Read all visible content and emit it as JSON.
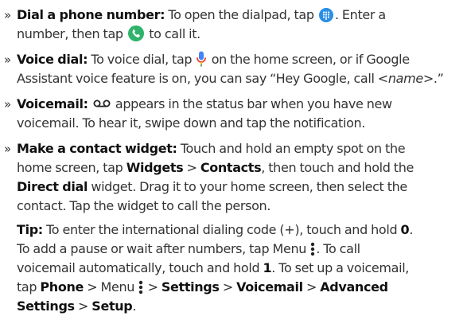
{
  "bullet_marker": "»",
  "items": [
    {
      "title": "Dial a phone number:",
      "text_1": " To open the dialpad, tap ",
      "icon_1": "dialpad-icon",
      "text_2": ". Enter a",
      "text_3": "number, then tap ",
      "icon_2": "phone-call-icon",
      "text_4": " to call it."
    },
    {
      "title": "Voice dial:",
      "text_1": " To voice dial, tap ",
      "icon_1": "microphone-icon",
      "text_2": " on the home screen, or if Google",
      "text_3": "Assistant voice feature is on, you can say “Hey Google, call <",
      "text_italic": "name",
      "text_4": ">.”"
    },
    {
      "title": "Voicemail:",
      "icon_1": "voicemail-icon",
      "text_1": " appears in the status bar when you have new",
      "text_2": "voicemail. To hear it, swipe down and tap the notification."
    },
    {
      "title": "Make a contact widget:",
      "text_1": " Touch and hold an empty spot on the",
      "text_2": "home screen, tap ",
      "bold_1": "Widgets",
      "text_3": " > ",
      "bold_2": "Contacts",
      "text_4": ", then touch and hold the",
      "bold_3": "Direct dial",
      "text_5": " widget. Drag it to your home screen, then select the",
      "text_6": "contact. Tap the widget to call the person."
    }
  ],
  "tip": {
    "title": "Tip:",
    "text_1": " To enter the international dialing code (+), touch and hold ",
    "bold_1": "0",
    "text_1b": ".",
    "text_2": "To add a pause or wait after numbers, tap Menu ",
    "icon_menu": "menu-dots-icon",
    "text_3": ". To call",
    "text_4": "voicemail automatically, touch and hold ",
    "bold_2": "1",
    "text_5": ". To set up a voicemail,",
    "text_6": "tap ",
    "bold_3": "Phone",
    "text_7": " > Menu ",
    "text_8": " > ",
    "bold_4": "Settings",
    "text_9": " > ",
    "bold_5": "Voicemail",
    "text_10": " > ",
    "bold_6": "Advanced",
    "bold_7": "Settings",
    "text_11": " > ",
    "bold_8": "Setup",
    "text_12": "."
  },
  "colors": {
    "text": "#333333",
    "dialpad_icon": "#2a8ee6",
    "call_icon": "#2fb36a",
    "mic_blue": "#4285f4",
    "mic_red": "#ea4335",
    "mic_yellow": "#fbbc05",
    "mic_green": "#34a853"
  }
}
